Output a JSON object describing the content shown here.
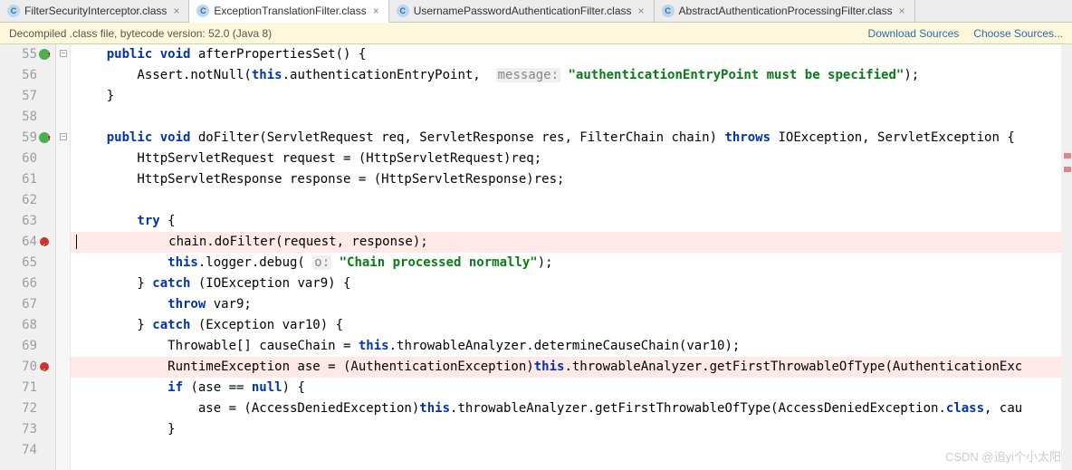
{
  "tabs": [
    {
      "label": "FilterSecurityInterceptor.class",
      "active": false
    },
    {
      "label": "ExceptionTranslationFilter.class",
      "active": true
    },
    {
      "label": "UsernamePasswordAuthenticationFilter.class",
      "active": false
    },
    {
      "label": "AbstractAuthenticationProcessingFilter.class",
      "active": false
    }
  ],
  "banner": {
    "text": "Decompiled .class file, bytecode version: 52.0 (Java 8)",
    "link1": "Download Sources",
    "link2": "Choose Sources..."
  },
  "lines": [
    {
      "n": "55",
      "mk": "ov"
    },
    {
      "n": "56"
    },
    {
      "n": "57"
    },
    {
      "n": "58"
    },
    {
      "n": "59",
      "mk": "ov"
    },
    {
      "n": "60"
    },
    {
      "n": "61"
    },
    {
      "n": "62"
    },
    {
      "n": "63"
    },
    {
      "n": "64",
      "mk": "bp"
    },
    {
      "n": "65"
    },
    {
      "n": "66"
    },
    {
      "n": "67"
    },
    {
      "n": "68"
    },
    {
      "n": "69"
    },
    {
      "n": "70",
      "mk": "bp"
    },
    {
      "n": "71"
    },
    {
      "n": "72"
    },
    {
      "n": "73"
    },
    {
      "n": "74"
    }
  ],
  "code": {
    "l55_1": "    public void ",
    "l55_2": "afterPropertiesSet() {",
    "l56_1": "        Assert.notNull(",
    "l56_2": "this",
    "l56_3": ".authenticationEntryPoint,  ",
    "l56_lbl": "message:",
    "l56_str": " \"authenticationEntryPoint must be specified\"",
    "l56_4": ");",
    "l57": "    }",
    "l59_1": "    public void ",
    "l59_2": "doFilter(ServletRequest req, ServletResponse res, FilterChain chain) ",
    "l59_3": "throws ",
    "l59_4": "IOException, ServletException {",
    "l60": "        HttpServletRequest request = (HttpServletRequest)req;",
    "l61": "        HttpServletResponse response = (HttpServletResponse)res;",
    "l63_1": "        try ",
    "l63_2": "{",
    "l64": "            chain.doFilter(request, response);",
    "l65_1": "            this",
    "l65_2": ".logger.debug( ",
    "l65_lbl": "o:",
    "l65_str": " \"Chain processed normally\"",
    "l65_3": ");",
    "l66_1": "        } ",
    "l66_2": "catch ",
    "l66_3": "(IOException var9) {",
    "l67_1": "            throw ",
    "l67_2": "var9;",
    "l68_1": "        } ",
    "l68_2": "catch ",
    "l68_3": "(Exception var10) {",
    "l69_1": "            Throwable[] causeChain = ",
    "l69_2": "this",
    "l69_3": ".throwableAnalyzer.determineCauseChain(var10);",
    "l70_1": "            RuntimeException ase = (AuthenticationException)",
    "l70_2": "this",
    "l70_3": ".throwableAnalyzer.getFirstThrowableOfType(AuthenticationExc",
    "l71_1": "            if ",
    "l71_2": "(ase == ",
    "l71_3": "null",
    "l71_4": ") {",
    "l72_1": "                ase = (AccessDeniedException)",
    "l72_2": "this",
    "l72_3": ".throwableAnalyzer.getFirstThrowableOfType(AccessDeniedException.",
    "l72_4": "class",
    "l72_5": ", cau",
    "l73": "            }"
  },
  "watermark": "CSDN @追yi个小太阳"
}
